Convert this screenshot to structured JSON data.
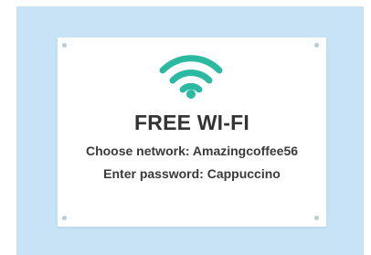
{
  "sign": {
    "title": "FREE WI-FI",
    "network_line": "Choose network: Amazingcoffee56",
    "password_line": "Enter password: Cappuccino",
    "icon": "wifi-icon"
  },
  "colors": {
    "backdrop": "#c7e3f5",
    "sign": "#ffffff",
    "wifi_accent": "#2bb9a1",
    "text": "#333333"
  }
}
